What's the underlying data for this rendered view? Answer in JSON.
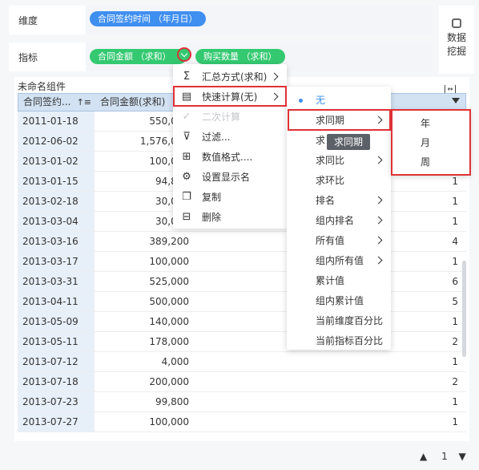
{
  "dimension": {
    "label": "维度",
    "pill": "合同签约时间 （年月日）"
  },
  "metric": {
    "label": "指标",
    "pills": [
      "合同金额 （求和）",
      "购买数量 （求和）"
    ]
  },
  "data_mining": {
    "label_line1": "数据",
    "label_line2": "挖掘"
  },
  "table": {
    "title": "未命名组件",
    "headers": [
      "合同签约...",
      "合同金额(求和)"
    ],
    "rows": [
      [
        "2011-01-18",
        "550,000",
        ""
      ],
      [
        "2012-06-02",
        "1,576,000",
        ""
      ],
      [
        "2013-01-02",
        "100,000",
        ""
      ],
      [
        "2013-01-15",
        "94,800",
        "1"
      ],
      [
        "2013-02-18",
        "30,000",
        "1"
      ],
      [
        "2013-03-04",
        "30,000",
        "1"
      ],
      [
        "2013-03-16",
        "389,200",
        "4"
      ],
      [
        "2013-03-17",
        "100,000",
        "1"
      ],
      [
        "2013-03-31",
        "525,000",
        "6"
      ],
      [
        "2013-04-11",
        "500,000",
        "5"
      ],
      [
        "2013-05-09",
        "140,000",
        "1"
      ],
      [
        "2013-05-11",
        "178,000",
        "2"
      ],
      [
        "2013-07-12",
        "4,000",
        "1"
      ],
      [
        "2013-07-18",
        "200,000",
        "2"
      ],
      [
        "2013-07-23",
        "99,800",
        "1"
      ],
      [
        "2013-07-27",
        "100,000",
        "1"
      ]
    ]
  },
  "pager": {
    "page": "1"
  },
  "menu1": {
    "items": [
      {
        "icon": "sigma-icon",
        "label": "汇总方式(求和)",
        "sub": true,
        "disabled": false
      },
      {
        "icon": "calculator-icon",
        "label": "快速计算(无)",
        "sub": true,
        "disabled": false
      },
      {
        "icon": "check-icon",
        "label": "二次计算",
        "sub": false,
        "disabled": true
      },
      {
        "icon": "filter-icon",
        "label": "过滤...",
        "sub": false,
        "disabled": false
      },
      {
        "icon": "number-format-icon",
        "label": "数值格式....",
        "sub": false,
        "disabled": false
      },
      {
        "icon": "gear-icon",
        "label": "设置显示名",
        "sub": false,
        "disabled": false
      },
      {
        "icon": "copy-icon",
        "label": "复制",
        "sub": false,
        "disabled": false
      },
      {
        "icon": "trash-icon",
        "label": "删除",
        "sub": false,
        "disabled": false
      }
    ]
  },
  "menu2": {
    "items": [
      {
        "label": "无",
        "sub": false,
        "selected": true
      },
      {
        "label": "求同期",
        "sub": true,
        "selected": false
      },
      {
        "label": "求",
        "sub": false,
        "selected": false
      },
      {
        "label": "求同比",
        "sub": true,
        "selected": false
      },
      {
        "label": "求环比",
        "sub": false,
        "selected": false
      },
      {
        "label": "排名",
        "sub": true,
        "selected": false
      },
      {
        "label": "组内排名",
        "sub": true,
        "selected": false
      },
      {
        "label": "所有值",
        "sub": true,
        "selected": false
      },
      {
        "label": "组内所有值",
        "sub": true,
        "selected": false
      },
      {
        "label": "累计值",
        "sub": false,
        "selected": false
      },
      {
        "label": "组内累计值",
        "sub": false,
        "selected": false
      },
      {
        "label": "当前维度百分比",
        "sub": false,
        "selected": false
      },
      {
        "label": "当前指标百分比",
        "sub": false,
        "selected": false
      }
    ]
  },
  "tooltip": "求同期",
  "menu3": {
    "items": [
      "年",
      "月",
      "周"
    ]
  },
  "colors": {
    "accent_blue": "#3f8ff0",
    "accent_green": "#34c971",
    "highlight_red": "#e03236",
    "header_bg": "#d2e2f3"
  }
}
